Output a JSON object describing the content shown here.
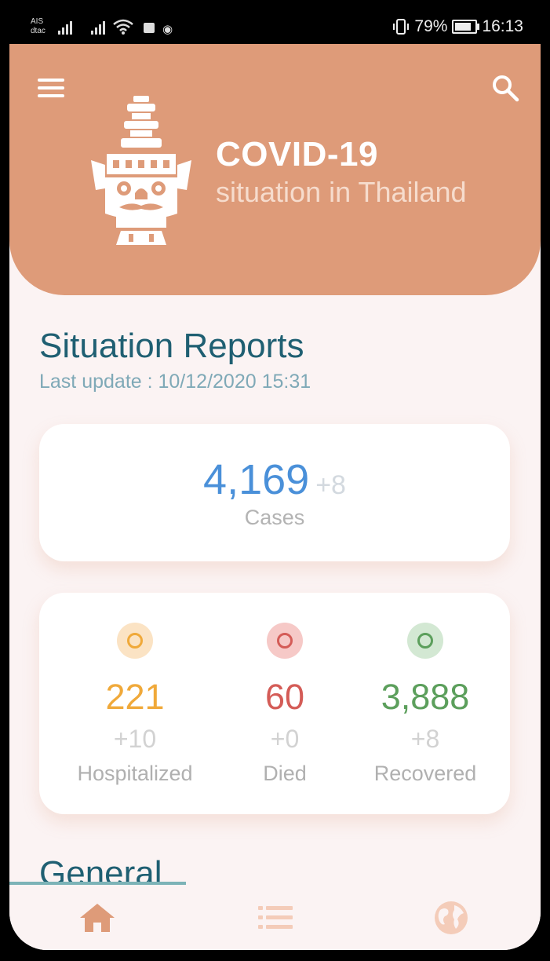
{
  "status_bar": {
    "carrier_1": "AIS",
    "carrier_2": "dtac",
    "battery": "79%",
    "time": "16:13"
  },
  "header": {
    "title": "COVID-19",
    "subtitle": "situation in Thailand",
    "color": "#de9b79"
  },
  "report": {
    "title": "Situation Reports",
    "last_update": "Last update : 10/12/2020 15:31",
    "cases": {
      "value": "4,169",
      "delta": "+8",
      "label": "Cases",
      "color": "#4a90d9"
    },
    "stats": [
      {
        "value": "221",
        "delta": "+10",
        "label": "Hospitalized",
        "color": "#f0a93a"
      },
      {
        "value": "60",
        "delta": "+0",
        "label": "Died",
        "color": "#d45c57"
      },
      {
        "value": "3,888",
        "delta": "+8",
        "label": "Recovered",
        "color": "#5c9f5c"
      }
    ]
  },
  "general": {
    "title": "General"
  },
  "nav": {
    "items": [
      "home-icon",
      "list-icon",
      "globe-icon"
    ],
    "active": "home-icon"
  }
}
